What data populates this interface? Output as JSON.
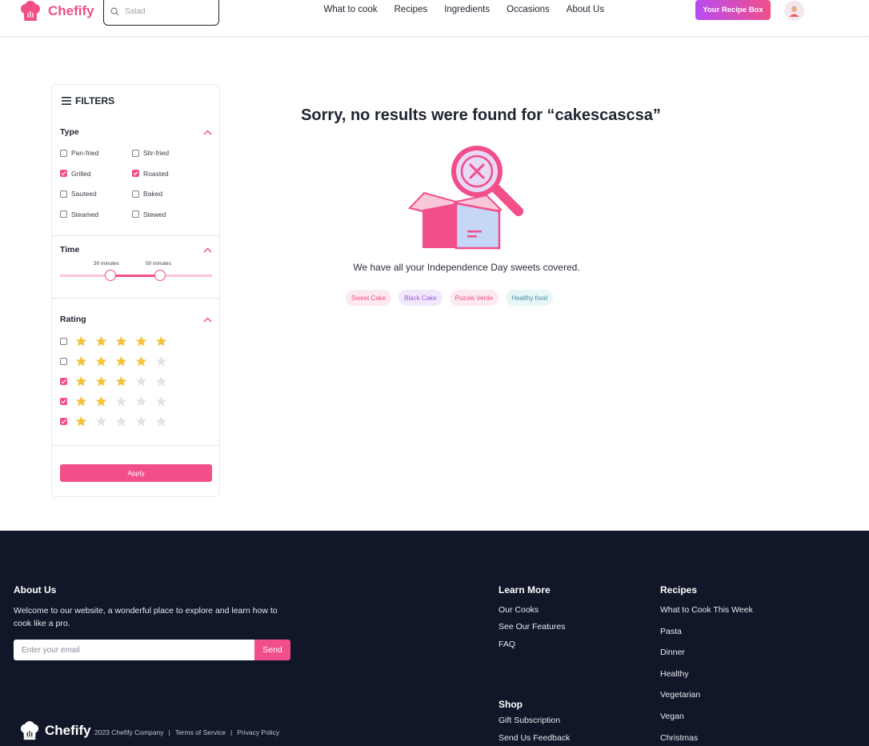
{
  "header": {
    "brand": "Chefify",
    "search_placeholder": "Salad",
    "nav": [
      "What to cook",
      "Recipes",
      "Ingredients",
      "Occasions",
      "About Us"
    ],
    "recipe_box_label": "Your Recipe Box"
  },
  "filters": {
    "title": "FILTERS",
    "type": {
      "heading": "Type",
      "options": [
        {
          "label": "Pan-fried",
          "checked": false
        },
        {
          "label": "Stir-fried",
          "checked": false
        },
        {
          "label": "Grilled",
          "checked": true
        },
        {
          "label": "Roasted",
          "checked": true
        },
        {
          "label": "Sauteed",
          "checked": false
        },
        {
          "label": "Baked",
          "checked": false
        },
        {
          "label": "Steamed",
          "checked": false
        },
        {
          "label": "Stewed",
          "checked": false
        }
      ]
    },
    "time": {
      "heading": "Time",
      "min_label": "30 minutes",
      "max_label": "50 minutes"
    },
    "rating": {
      "heading": "Rating",
      "rows": [
        {
          "stars": 5,
          "checked": false
        },
        {
          "stars": 4,
          "checked": false
        },
        {
          "stars": 3,
          "checked": true
        },
        {
          "stars": 2,
          "checked": true
        },
        {
          "stars": 1,
          "checked": true
        }
      ]
    },
    "apply_label": "Apply"
  },
  "main": {
    "message": "Sorry, no results were found for “cakescascsa”",
    "subtext": "We have all your Independence Day sweets covered.",
    "tags": [
      "Sweet Cake",
      "Black Cake",
      "Pozole Verde",
      "Healthy food"
    ]
  },
  "footer": {
    "about": {
      "heading": "About Us",
      "text": "Welcome to our website, a wonderful place to explore and learn how to cook like a pro.",
      "email_placeholder": "Enter your email",
      "send_label": "Send"
    },
    "learn_more": {
      "heading": "Learn More",
      "links": [
        "Our Cooks",
        "See Our Features",
        "FAQ"
      ]
    },
    "shop": {
      "heading": "Shop",
      "links": [
        "Gift Subscription",
        "Send Us Feedback"
      ]
    },
    "recipes": {
      "heading": "Recipes",
      "links": [
        "What to Cook This Week",
        "Pasta",
        "Dinner",
        "Healthy",
        "Vegetarian",
        "Vegan",
        "Christmas"
      ]
    },
    "brand": "Chefify",
    "copyright": "2023 Chefify Company",
    "terms": "Terms of Service",
    "privacy": "Privacy Policy"
  },
  "colors": {
    "accent": "#f14e8a",
    "accent_purple": "#b84cf2",
    "star_on": "#f5c33b",
    "star_off": "#e3e4ea",
    "footer_bg": "#111728"
  }
}
